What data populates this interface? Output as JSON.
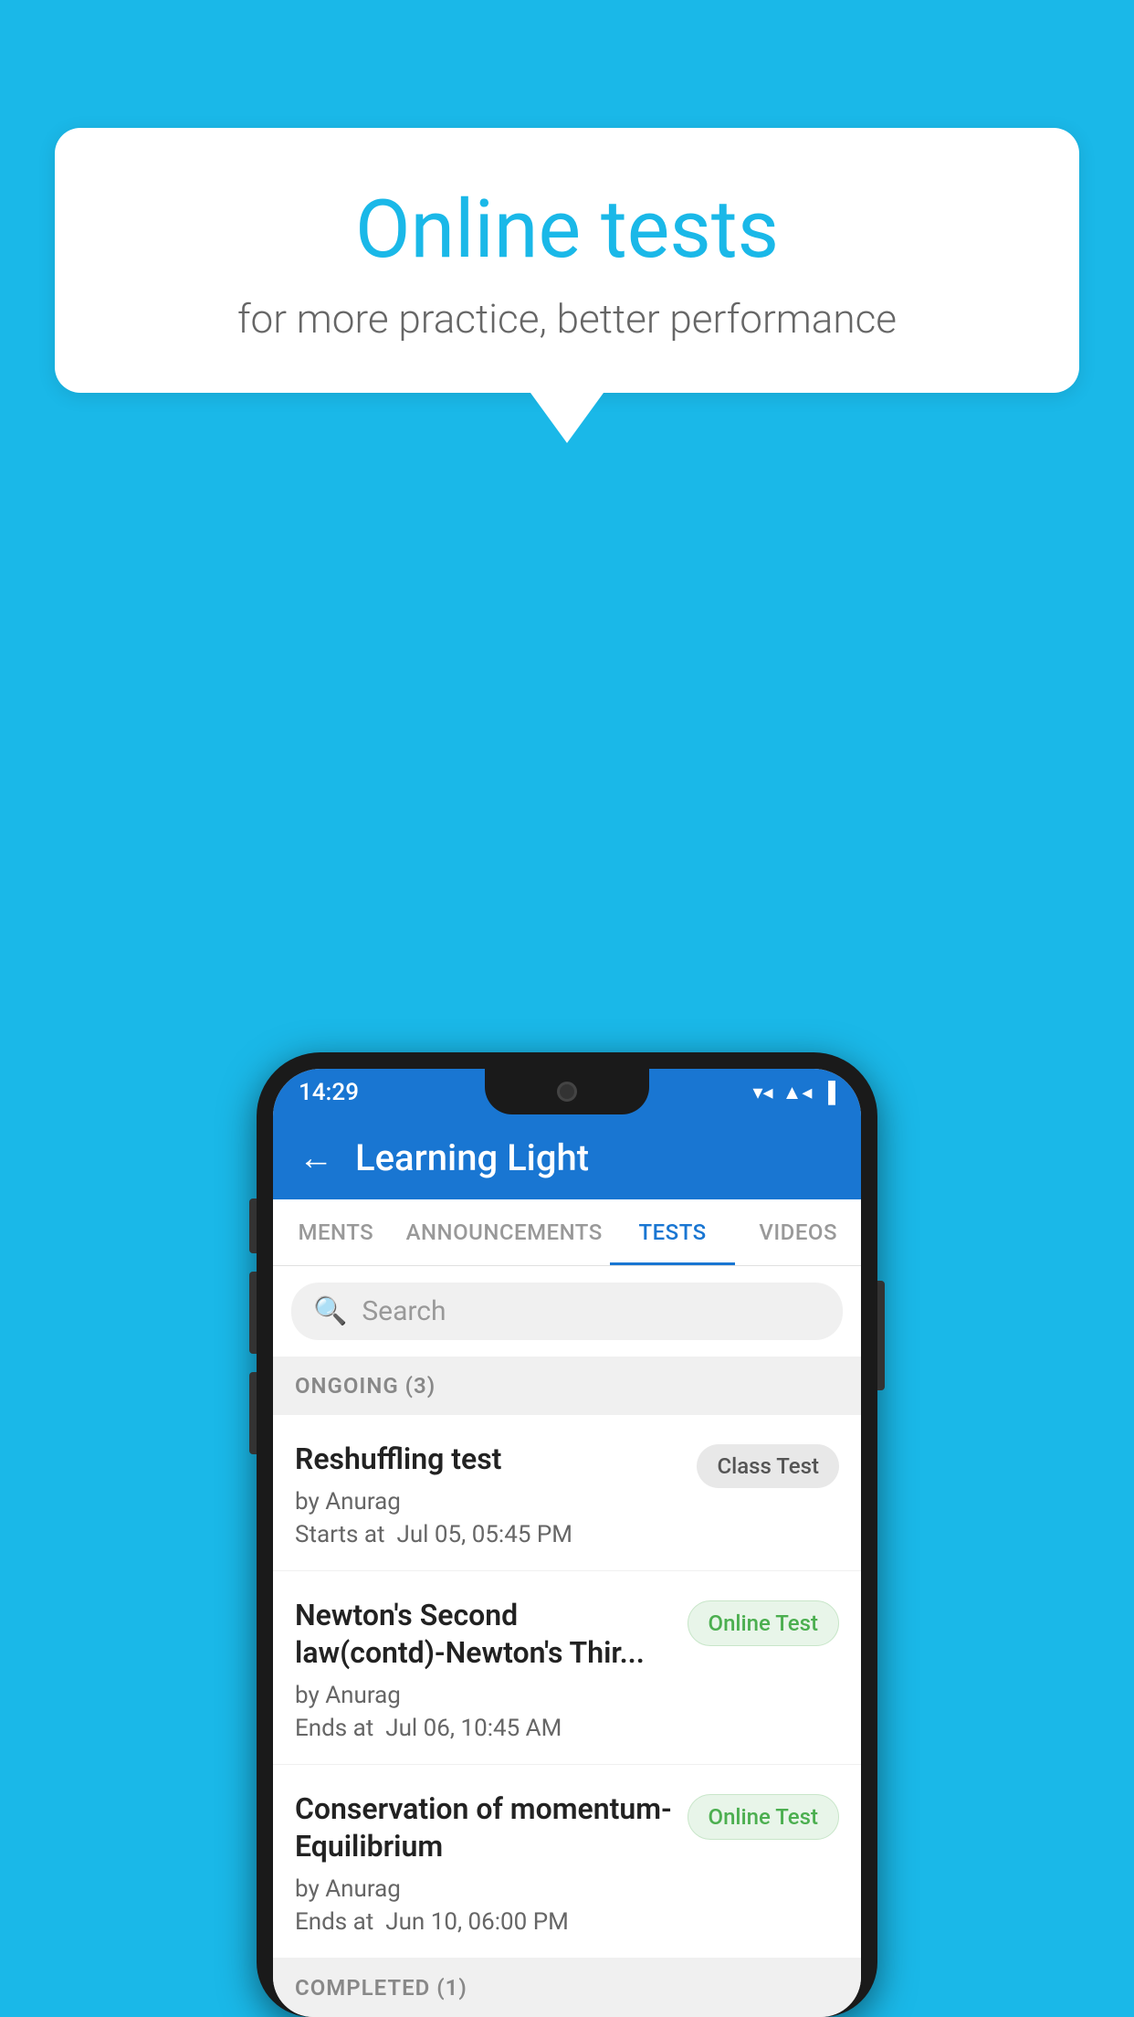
{
  "background_color": "#1ab8e8",
  "speech_bubble": {
    "title": "Online tests",
    "subtitle": "for more practice, better performance"
  },
  "phone": {
    "status_bar": {
      "time": "14:29",
      "wifi": "▼",
      "signal": "▲",
      "battery": "▐"
    },
    "header": {
      "back_label": "←",
      "title": "Learning Light"
    },
    "tabs": [
      {
        "label": "MENTS",
        "active": false
      },
      {
        "label": "ANNOUNCEMENTS",
        "active": false
      },
      {
        "label": "TESTS",
        "active": true
      },
      {
        "label": "VIDEOS",
        "active": false
      }
    ],
    "search": {
      "placeholder": "Search"
    },
    "ongoing_section": {
      "label": "ONGOING (3)"
    },
    "tests": [
      {
        "name": "Reshuffling test",
        "author": "by Anurag",
        "time_label": "Starts at",
        "time": "Jul 05, 05:45 PM",
        "badge": "Class Test",
        "badge_type": "class"
      },
      {
        "name": "Newton's Second law(contd)-Newton's Thir...",
        "author": "by Anurag",
        "time_label": "Ends at",
        "time": "Jul 06, 10:45 AM",
        "badge": "Online Test",
        "badge_type": "online"
      },
      {
        "name": "Conservation of momentum-Equilibrium",
        "author": "by Anurag",
        "time_label": "Ends at",
        "time": "Jun 10, 06:00 PM",
        "badge": "Online Test",
        "badge_type": "online"
      }
    ],
    "completed_section": {
      "label": "COMPLETED (1)"
    }
  }
}
